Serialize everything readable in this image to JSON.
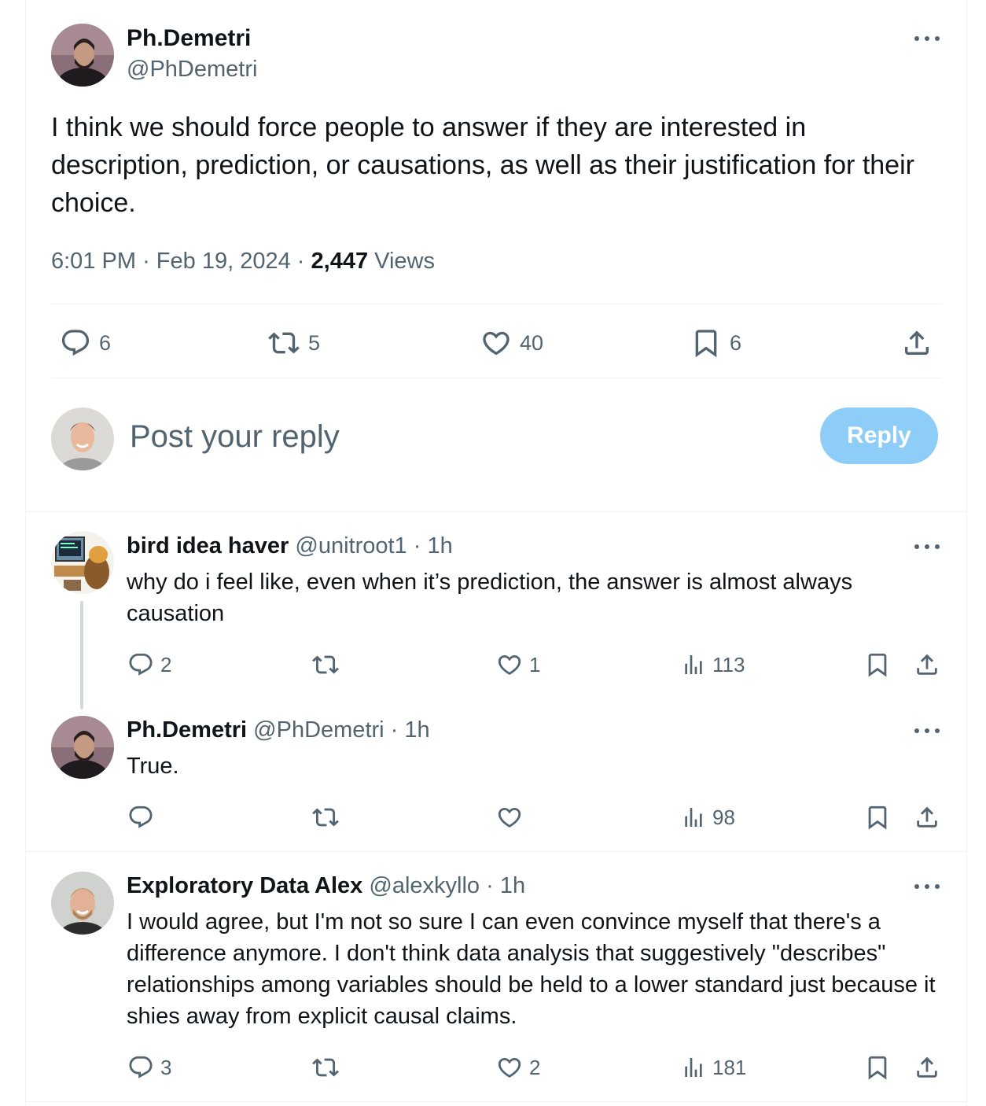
{
  "main_tweet": {
    "author_name": "Ph.Demetri",
    "author_handle": "@PhDemetri",
    "text": "I think we should force people to answer if they are interested in description, prediction, or causations, as well as their justification for their choice.",
    "time": "6:01 PM",
    "date": "Feb 19, 2024",
    "views_count": "2,447",
    "views_label": "Views",
    "stats": {
      "replies": "6",
      "reposts": "5",
      "likes": "40",
      "bookmarks": "6"
    }
  },
  "composer": {
    "placeholder": "Post your reply",
    "button_label": "Reply"
  },
  "replies": [
    {
      "author_name": "bird idea haver",
      "author_handle": "@unitroot1",
      "time": "1h",
      "text": "why do i feel like, even when it’s prediction, the answer is almost always causation",
      "replies": "2",
      "reposts": "",
      "likes": "1",
      "views": "113"
    },
    {
      "author_name": "Ph.Demetri",
      "author_handle": "@PhDemetri",
      "time": "1h",
      "text": "True.",
      "replies": "",
      "reposts": "",
      "likes": "",
      "views": "98"
    },
    {
      "author_name": "Exploratory Data Alex",
      "author_handle": "@alexkyllo",
      "time": "1h",
      "text": "I would agree, but I'm not so sure I can even convince myself that there's a difference anymore. I don't think data analysis that suggestively \"describes\" relationships among variables should be held to a lower standard just because it shies away from explicit causal claims.",
      "replies": "3",
      "reposts": "",
      "likes": "2",
      "views": "181"
    }
  ],
  "separator": "·",
  "colors": {
    "accent": "#1d9bf0",
    "reply_button_disabled": "#8ecdf7",
    "secondary_text": "#536471",
    "divider": "#eff3f4"
  },
  "icons": [
    "more-icon",
    "reply-icon",
    "repost-icon",
    "like-icon",
    "bookmark-icon",
    "share-icon",
    "views-icon"
  ]
}
